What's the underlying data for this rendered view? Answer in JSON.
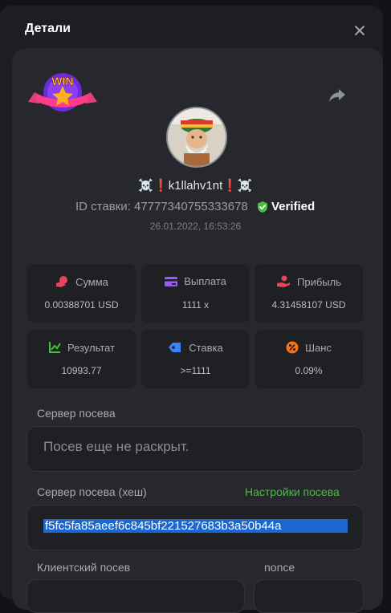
{
  "modal": {
    "title": "Детали"
  },
  "user": {
    "name": "☠️❗k1llahv1nt❗☠️"
  },
  "bet": {
    "id_label": "ID ставки: 47777340755333678",
    "verified_label": "Verified",
    "datetime": "26.01.2022, 16:53:26"
  },
  "badge": {
    "text": "WIN"
  },
  "stats": [
    {
      "label": "Сумма",
      "value": "0.00388701 USD",
      "icon": "coins-icon",
      "color": "#e8445b"
    },
    {
      "label": "Выплата",
      "value": "1111 x",
      "icon": "card-icon",
      "color": "#9b5cf6"
    },
    {
      "label": "Прибыль",
      "value": "4.31458107 USD",
      "icon": "hand-money-icon",
      "color": "#e8445b"
    },
    {
      "label": "Результат",
      "value": "10993.77",
      "icon": "chart-icon",
      "color": "#45c23a"
    },
    {
      "label": "Ставка",
      "value": ">=1111",
      "icon": "tag-icon",
      "color": "#3b82f6"
    },
    {
      "label": "Шанс",
      "value": "0.09%",
      "icon": "percent-icon",
      "color": "#f97316"
    }
  ],
  "seed": {
    "server_label": "Сервер посева",
    "server_placeholder": "Посев еще не раскрыт.",
    "hash_label": "Сервер посева (хеш)",
    "settings_link": "Настройки посева",
    "hash_value": "f5fc5fa85aeef6c845bf221527683b3a50b44a",
    "client_label": "Клиентский посев",
    "nonce_label": "nonce"
  }
}
